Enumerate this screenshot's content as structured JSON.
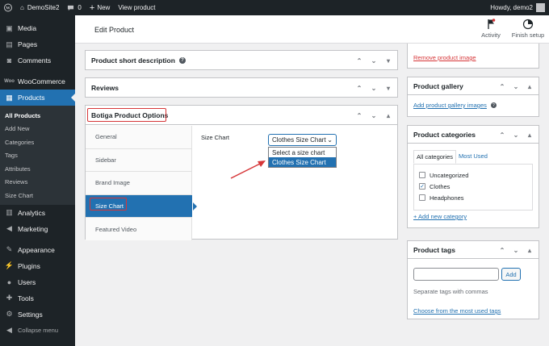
{
  "adminbar": {
    "site_name": "DemoSite2",
    "comments_count": "0",
    "new_label": "New",
    "view_product": "View product",
    "howdy": "Howdy, demo2"
  },
  "sidebar": {
    "items": [
      {
        "label": "Media",
        "icon": "media-icon"
      },
      {
        "label": "Pages",
        "icon": "pages-icon"
      },
      {
        "label": "Comments",
        "icon": "comments-icon"
      },
      {
        "label": "WooCommerce",
        "icon": "woocommerce-icon"
      },
      {
        "label": "Products",
        "icon": "products-icon"
      },
      {
        "label": "Analytics",
        "icon": "analytics-icon"
      },
      {
        "label": "Marketing",
        "icon": "marketing-icon"
      },
      {
        "label": "Appearance",
        "icon": "appearance-icon"
      },
      {
        "label": "Plugins",
        "icon": "plugins-icon"
      },
      {
        "label": "Users",
        "icon": "users-icon"
      },
      {
        "label": "Tools",
        "icon": "tools-icon"
      },
      {
        "label": "Settings",
        "icon": "settings-icon"
      },
      {
        "label": "Collapse menu",
        "icon": "collapse-icon"
      }
    ],
    "submenu": [
      "All Products",
      "Add New",
      "Categories",
      "Tags",
      "Attributes",
      "Reviews",
      "Size Chart"
    ]
  },
  "header": {
    "title": "Edit Product",
    "activity": "Activity",
    "finish_setup": "Finish setup"
  },
  "main": {
    "short_description": "Product short description",
    "reviews": "Reviews",
    "options_title": "Botiga Product Options",
    "tabs": [
      "General",
      "Sidebar",
      "Brand Image",
      "Size Chart",
      "Featured Video"
    ],
    "size_chart_label": "Size Chart",
    "select_value": "Clothes Size Chart",
    "options": [
      "Select a size chart",
      "Clothes Size Chart"
    ]
  },
  "right": {
    "remove_image": "Remove product image",
    "gallery_title": "Product gallery",
    "add_gallery": "Add product gallery images",
    "categories_title": "Product categories",
    "all_categories": "All categories",
    "most_used": "Most Used",
    "categories": [
      {
        "label": "Uncategorized",
        "checked": false
      },
      {
        "label": "Clothes",
        "checked": true
      },
      {
        "label": "Headphones",
        "checked": false
      }
    ],
    "add_category": "+ Add new category",
    "tags_title": "Product tags",
    "add_btn": "Add",
    "tags_hint": "Separate tags with commas",
    "choose_tags": "Choose from the most used tags"
  },
  "colors": {
    "admin_dark": "#1d2327",
    "accent_blue": "#2271b1",
    "highlight_red": "#d63638",
    "arrow_red": "#d63638"
  }
}
